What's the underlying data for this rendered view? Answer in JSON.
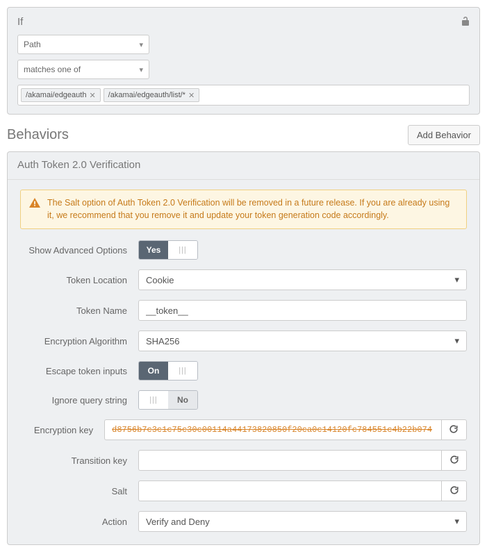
{
  "if": {
    "title": "If",
    "field": "Path",
    "operator": "matches one of",
    "tags": [
      "/akamai/edgeauth",
      "/akamai/edgeauth/list/*"
    ]
  },
  "behaviors": {
    "title": "Behaviors",
    "add_button": "Add Behavior"
  },
  "auth": {
    "title": "Auth Token 2.0 Verification",
    "warning": "The Salt option of Auth Token 2.0 Verification will be removed in a future release. If you are already using it, we recommend that you remove it and update your token generation code accordingly.",
    "labels": {
      "adv": "Show Advanced Options",
      "loc": "Token Location",
      "name": "Token Name",
      "alg": "Encryption Algorithm",
      "esc": "Escape token inputs",
      "ign": "Ignore query string",
      "key": "Encryption key",
      "trans": "Transition key",
      "salt": "Salt",
      "action": "Action"
    },
    "values": {
      "adv_on": "Yes",
      "loc": "Cookie",
      "name": "__token__",
      "alg": "SHA256",
      "esc_on": "On",
      "ign_no": "No",
      "key": "d8756b7c3c1c75c30c00114a44173820850f20ca0c14120fc784551c4b22b074",
      "trans": "",
      "salt": "",
      "action": "Verify and Deny"
    }
  }
}
